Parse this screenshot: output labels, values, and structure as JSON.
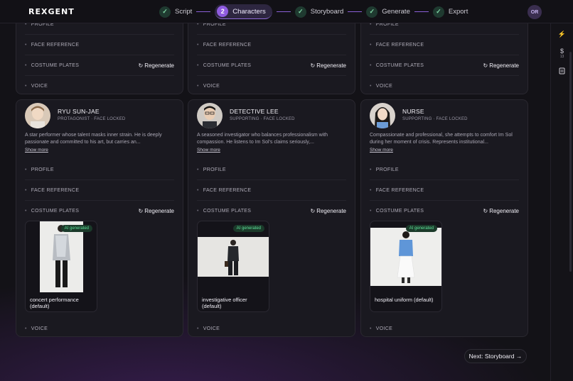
{
  "app": {
    "logo": "REXGENT"
  },
  "steps": [
    {
      "label": "Script",
      "state": "done",
      "marker": "✓"
    },
    {
      "label": "Characters",
      "state": "active",
      "marker": "2"
    },
    {
      "label": "Storyboard",
      "state": "done",
      "marker": "✓"
    },
    {
      "label": "Generate",
      "state": "done",
      "marker": "✓"
    },
    {
      "label": "Export",
      "state": "done",
      "marker": "✓"
    }
  ],
  "user": {
    "initials": "OR"
  },
  "rail": {
    "credit_symbol": "$",
    "credit_count": "13"
  },
  "rows": {
    "profile": "PROFILE",
    "face_reference": "FACE REFERENCE",
    "costume_plates": "COSTUME PLATES",
    "voice": "VOICE",
    "regenerate": "Regenerate"
  },
  "show_more": "Show more",
  "ai_badge": "AI generated",
  "characters": [
    {
      "name": "RYU SUN-JAE",
      "role": "PROTAGONIST · FACE LOCKED",
      "description": "A star performer whose talent masks inner strain. He is deeply passionate and committed to his art, but carries an...",
      "plate_label": "concert performance (default)"
    },
    {
      "name": "DETECTIVE LEE",
      "role": "SUPPORTING · FACE LOCKED",
      "description": "A seasoned investigator who balances professionalism with compassion. He listens to Im Sol's claims seriously,...",
      "plate_label": "investigative officer (default)"
    },
    {
      "name": "NURSE",
      "role": "SUPPORTING · FACE LOCKED",
      "description": "Compassionate and professional, she attempts to comfort Im Sol during her moment of crisis. Represents institutional...",
      "plate_label": "hospital uniform (default)"
    }
  ],
  "next_button": "Next: Storyboard →"
}
